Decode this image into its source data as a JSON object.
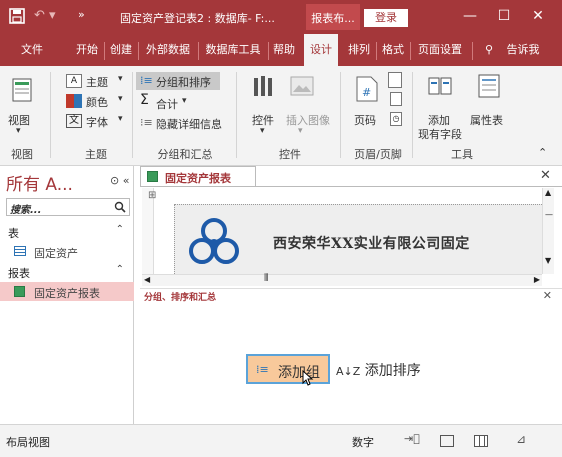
{
  "titlebar": {
    "title": "固定资产登记表2 : 数据库- F:...",
    "context_tab": "报表布...",
    "login": "登录",
    "quick_access_more": "»",
    "min_label": "—",
    "max_label": "☐",
    "close_label": "✕"
  },
  "tabs": [
    "文件",
    "开始",
    "创建",
    "外部数据",
    "数据库工具",
    "帮助",
    "设计",
    "排列",
    "格式",
    "页面设置",
    "告诉我"
  ],
  "ribbon": {
    "view": {
      "label": "视图",
      "group": "视图"
    },
    "theme": {
      "theme": "主题",
      "colors": "颜色",
      "fonts": "字体",
      "group": "主题"
    },
    "grouping": {
      "group_sort": "分组和排序",
      "totals": "合计",
      "hide_details": "隐藏详细信息",
      "group": "分组和汇总"
    },
    "controls": {
      "controls": "控件",
      "insert_image": "插入图像",
      "group": "控件"
    },
    "header_footer": {
      "page_number": "页码",
      "group": "页眉/页脚"
    },
    "tools": {
      "add_fields_1": "添加",
      "add_fields_2": "现有字段",
      "property_sheet": "属性表",
      "group": "工具"
    }
  },
  "nav": {
    "header": "所有 A...",
    "header_ctl": "⊙ «",
    "search_placeholder": "搜索...",
    "sections": [
      {
        "title": "表",
        "items": [
          "固定资产"
        ]
      },
      {
        "title": "报表",
        "items": [
          "固定资产报表"
        ]
      }
    ]
  },
  "document": {
    "tab_title": "固定资产报表",
    "banner_text": "西安荣华XX实业有限公司固定",
    "group_sort_title": "分组、排序和汇总",
    "add_group": "添加组",
    "add_sort": "添加排序"
  },
  "status": {
    "view": "布局视图",
    "numlock": "数字"
  },
  "colors": {
    "accent": "#a4373a",
    "selected_nav": "#f5c9c9",
    "add_group_bg": "#f8c99b",
    "focus_border": "#5ba3d9"
  }
}
